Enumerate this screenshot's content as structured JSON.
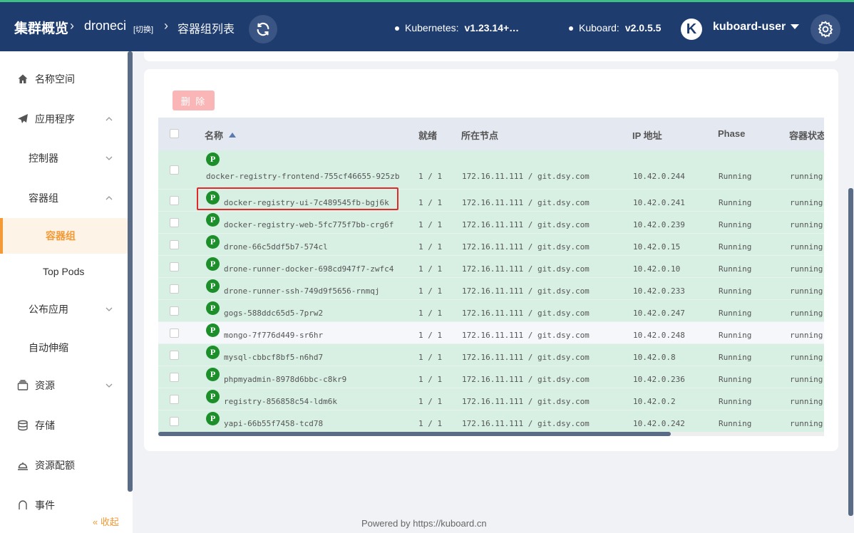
{
  "header": {
    "title": "集群概览",
    "namespace": "droneci",
    "switch": "[切换]",
    "page": "容器组列表",
    "kubernetes_label": "Kubernetes:",
    "kubernetes_version": "v1.23.14+…",
    "kuboard_label": "Kuboard:",
    "kuboard_version": "v2.0.5.5",
    "avatar_letter": "K",
    "username": "kuboard-user"
  },
  "sidebar": {
    "items": [
      {
        "label": "名称空间",
        "icon": "home-icon"
      },
      {
        "label": "应用程序",
        "icon": "paper-plane-icon"
      },
      {
        "label": "控制器"
      },
      {
        "label": "容器组"
      },
      {
        "label": "容器组"
      },
      {
        "label": "Top Pods"
      },
      {
        "label": "公布应用"
      },
      {
        "label": "自动伸缩"
      },
      {
        "label": "资源",
        "icon": "stack-icon"
      },
      {
        "label": "存储",
        "icon": "database-icon"
      },
      {
        "label": "资源配额",
        "icon": "bell-icon"
      },
      {
        "label": "事件",
        "icon": "event-icon"
      }
    ],
    "collapse": "« 收起"
  },
  "toolbar": {
    "delete_label": "删 除"
  },
  "table": {
    "columns": [
      "名称",
      "就绪",
      "所在节点",
      "IP 地址",
      "Phase",
      "容器状态"
    ],
    "phase_badge": "P",
    "rows": [
      {
        "name": "docker-registry-frontend-755cf46655-925zb",
        "ready": "1 / 1",
        "node": "172.16.11.111 / git.dsy.com",
        "ip": "10.42.0.244",
        "phase": "Running",
        "state": "running"
      },
      {
        "name": "docker-registry-ui-7c489545fb-bgj6k",
        "ready": "1 / 1",
        "node": "172.16.11.111 / git.dsy.com",
        "ip": "10.42.0.241",
        "phase": "Running",
        "state": "running"
      },
      {
        "name": "docker-registry-web-5fc775f7bb-crg6f",
        "ready": "1 / 1",
        "node": "172.16.11.111 / git.dsy.com",
        "ip": "10.42.0.239",
        "phase": "Running",
        "state": "running"
      },
      {
        "name": "drone-66c5ddf5b7-574cl",
        "ready": "1 / 1",
        "node": "172.16.11.111 / git.dsy.com",
        "ip": "10.42.0.15",
        "phase": "Running",
        "state": "running"
      },
      {
        "name": "drone-runner-docker-698cd947f7-zwfc4",
        "ready": "1 / 1",
        "node": "172.16.11.111 / git.dsy.com",
        "ip": "10.42.0.10",
        "phase": "Running",
        "state": "running"
      },
      {
        "name": "drone-runner-ssh-749d9f5656-rnmqj",
        "ready": "1 / 1",
        "node": "172.16.11.111 / git.dsy.com",
        "ip": "10.42.0.233",
        "phase": "Running",
        "state": "running"
      },
      {
        "name": "gogs-588ddc65d5-7prw2",
        "ready": "1 / 1",
        "node": "172.16.11.111 / git.dsy.com",
        "ip": "10.42.0.247",
        "phase": "Running",
        "state": "running"
      },
      {
        "name": "mongo-7f776d449-sr6hr",
        "ready": "1 / 1",
        "node": "172.16.11.111 / git.dsy.com",
        "ip": "10.42.0.248",
        "phase": "Running",
        "state": "running"
      },
      {
        "name": "mysql-cbbcf8bf5-n6hd7",
        "ready": "1 / 1",
        "node": "172.16.11.111 / git.dsy.com",
        "ip": "10.42.0.8",
        "phase": "Running",
        "state": "running"
      },
      {
        "name": "phpmyadmin-8978d6bbc-c8kr9",
        "ready": "1 / 1",
        "node": "172.16.11.111 / git.dsy.com",
        "ip": "10.42.0.236",
        "phase": "Running",
        "state": "running"
      },
      {
        "name": "registry-856858c54-ldm6k",
        "ready": "1 / 1",
        "node": "172.16.11.111 / git.dsy.com",
        "ip": "10.42.0.2",
        "phase": "Running",
        "state": "running"
      },
      {
        "name": "yapi-66b55f7458-tcd78",
        "ready": "1 / 1",
        "node": "172.16.11.111 / git.dsy.com",
        "ip": "10.42.0.242",
        "phase": "Running",
        "state": "running"
      }
    ]
  },
  "footer": {
    "powered_by": "Powered by",
    "link": "https://kuboard.cn"
  },
  "colors": {
    "header_bg": "#1e3c6e",
    "accent": "#f39a37",
    "row_bg": "#d8f0e4",
    "badge": "#1d8f2a",
    "highlight": "#e02a2a"
  }
}
